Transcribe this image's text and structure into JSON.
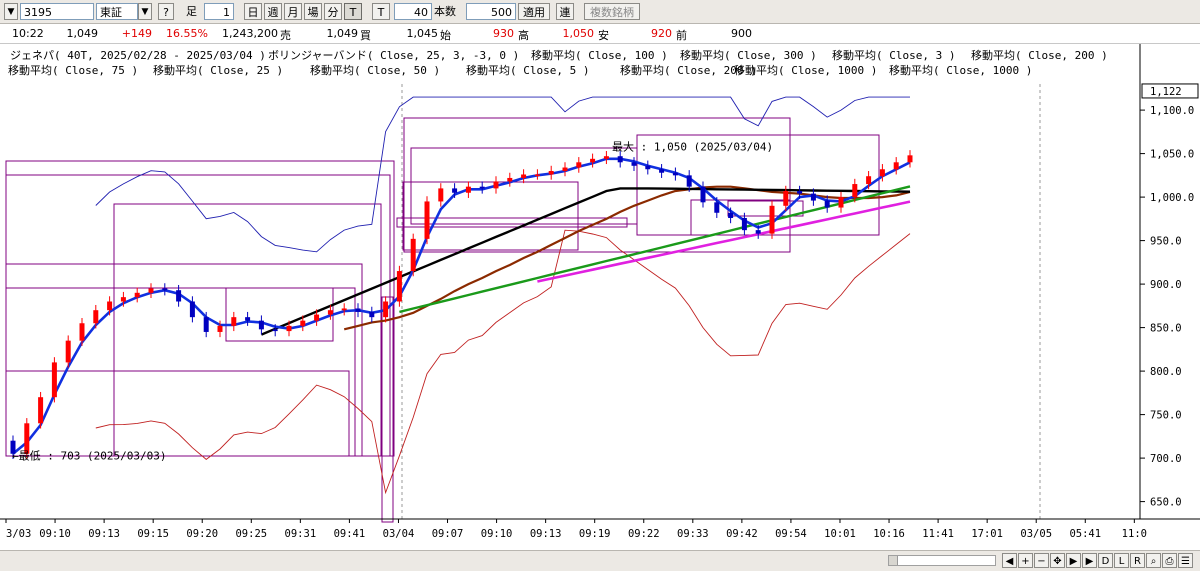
{
  "toolbar": {
    "code": "3195",
    "market": "東証",
    "help": "?",
    "ashi_label": "足",
    "ashi_value": "1",
    "periods": [
      "日",
      "週",
      "月",
      "場",
      "分",
      "T"
    ],
    "active_period": "T",
    "t_label": "T",
    "t_value": "40",
    "honsu_label": "本数",
    "honsu_value": "500",
    "apply": "適用",
    "ren": "連",
    "multi": "複数銘柄"
  },
  "quote": {
    "time": "10:22",
    "price": "1,049",
    "change": "+149",
    "change_pct": "16.55%",
    "volume": "1,243,200",
    "sell_label": "売",
    "sell": "1,049",
    "buy_label": "買",
    "buy": "1,045",
    "open_label": "始",
    "open": "930",
    "high_label": "高",
    "high": "1,050",
    "low_label": "安",
    "low": "920",
    "prev_label": "前",
    "prev": "900"
  },
  "legend": {
    "row1": [
      "ジェネパ( 40T, 2025/02/28 - 2025/03/04 )",
      "ボリンジャーバンド( Close, 25, 3, -3, 0 )",
      "移動平均( Close, 100 )",
      "移動平均( Close, 300 )",
      "移動平均( Close, 3 )",
      "移動平均( Close, 200 )"
    ],
    "row2": [
      "移動平均( Close, 75 )",
      "移動平均( Close, 25 )",
      "移動平均( Close, 50 )",
      "移動平均( Close, 5 )",
      "移動平均( Close, 200 )",
      "移動平均( Close, 1000 )",
      "移動平均( Close, 1000 )"
    ]
  },
  "annotations": {
    "max": "最大 : 1,050 (2025/03/04)",
    "min": "←最低 : 703 (2025/03/03)",
    "last_price_box": "1,122"
  },
  "colors": {
    "candle_up": "#ff0000",
    "candle_down": "#0000c0",
    "ma_fast": "#1030e0",
    "ma_brown": "#8b2a00",
    "ma_black": "#000000",
    "ma_green": "#1a9a1a",
    "ma_magenta": "#e020e0",
    "boll_upper": "#2020b0",
    "boll_lower": "#c02020",
    "box": "#800080"
  },
  "chart_data": {
    "type": "candlestick",
    "x_tick_labels": [
      "3/03",
      "09:10",
      "09:13",
      "09:15",
      "09:20",
      "09:25",
      "09:31",
      "09:41",
      "03/04",
      "09:07",
      "09:10",
      "09:13",
      "09:19",
      "09:22",
      "09:33",
      "09:42",
      "09:54",
      "10:01",
      "10:16",
      "11:41",
      "17:01",
      "03/05",
      "05:41",
      "11:0"
    ],
    "y_tick_labels": [
      "650.0",
      "700.0",
      "750.0",
      "800.0",
      "850.0",
      "900.0",
      "950.0",
      "1,000.0",
      "1,050.0",
      "1,100.0"
    ],
    "y_range": [
      630,
      1130
    ],
    "close": [
      705,
      740,
      770,
      810,
      835,
      855,
      870,
      880,
      885,
      890,
      895,
      893,
      880,
      862,
      845,
      852,
      862,
      858,
      848,
      846,
      852,
      858,
      865,
      870,
      872,
      868,
      862,
      880,
      915,
      952,
      995,
      1010,
      1005,
      1012,
      1010,
      1018,
      1022,
      1026,
      1026,
      1030,
      1034,
      1040,
      1044,
      1047,
      1040,
      1036,
      1032,
      1028,
      1025,
      1012,
      994,
      982,
      976,
      962,
      958,
      990,
      1007,
      1004,
      996,
      988,
      1000,
      1015,
      1024,
      1032,
      1040,
      1048
    ],
    "series": [
      {
        "name": "移動平均( Close, 3 )",
        "values": [
          705,
          718,
          738,
          773,
          805,
          833,
          853,
          868,
          878,
          885,
          890,
          893,
          889,
          878,
          862,
          853,
          853,
          857,
          856,
          851,
          849,
          852,
          858,
          864,
          869,
          870,
          867,
          870,
          886,
          916,
          954,
          986,
          1003,
          1009,
          1009,
          1013,
          1017,
          1022,
          1025,
          1027,
          1030,
          1035,
          1039,
          1044,
          1044,
          1041,
          1036,
          1032,
          1028,
          1022,
          1010,
          996,
          984,
          973,
          965,
          970,
          985,
          1000,
          1002,
          996,
          995,
          1001,
          1013,
          1024,
          1032,
          1040
        ]
      },
      {
        "name": "移動平均( Close, 25 )",
        "values": [
          null,
          null,
          null,
          null,
          null,
          null,
          null,
          null,
          null,
          null,
          null,
          null,
          null,
          null,
          null,
          null,
          null,
          null,
          null,
          null,
          null,
          null,
          null,
          null,
          848,
          852,
          856,
          858,
          862,
          867,
          875,
          883,
          892,
          900,
          907,
          915,
          922,
          930,
          937,
          945,
          953,
          961,
          968,
          975,
          983,
          990,
          996,
          1002,
          1007,
          1009,
          1011,
          1012,
          1012,
          1010,
          1008,
          1006,
          1005,
          1004,
          1002,
          1000,
          999,
          999,
          999,
          1000,
          1002,
          1006
        ]
      },
      {
        "name": "移動平均( Close, 75 )",
        "values": [
          null,
          null,
          null,
          null,
          null,
          null,
          null,
          null,
          null,
          null,
          null,
          null,
          null,
          null,
          null,
          null,
          null,
          null,
          null,
          null,
          null,
          null,
          null,
          null,
          null,
          null,
          null,
          null,
          null,
          null,
          null,
          null,
          null,
          null,
          null,
          null,
          null,
          null,
          null,
          null,
          null,
          null,
          null,
          null,
          null,
          null,
          null,
          null,
          null,
          null,
          null,
          null,
          null,
          null,
          null,
          null,
          null,
          null,
          null,
          null,
          null,
          null,
          null,
          null,
          null,
          null
        ]
      }
    ]
  }
}
